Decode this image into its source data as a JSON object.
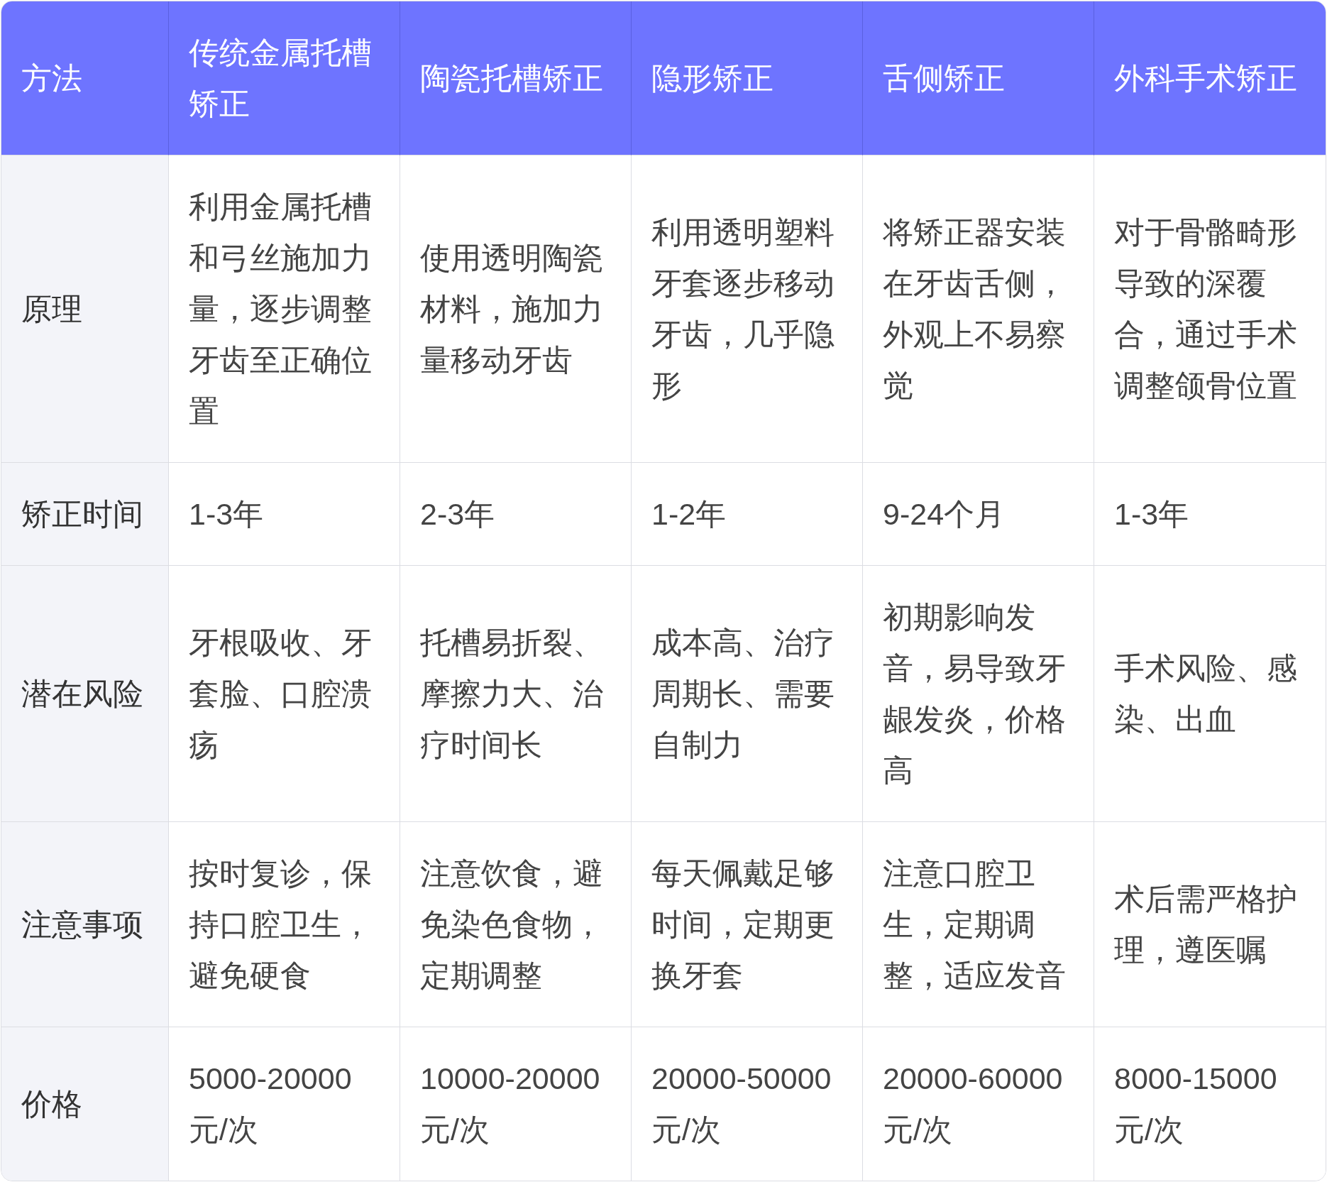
{
  "table": {
    "columns": [
      "方法",
      "传统金属托槽矫正",
      "陶瓷托槽矫正",
      "隐形矫正",
      "舌侧矫正",
      "外科手术矫正"
    ],
    "rows": [
      {
        "cells": [
          "原理",
          "利用金属托槽和弓丝施加力量，逐步调整牙齿至正确位置",
          "使用透明陶瓷材料，施加力量移动牙齿",
          "利用透明塑料牙套逐步移动牙齿，几乎隐形",
          "将矫正器安装在牙齿舌侧，外观上不易察觉",
          "对于骨骼畸形导致的深覆合，通过手术调整颌骨位置"
        ]
      },
      {
        "cells": [
          "矫正时间",
          "1-3年",
          "2-3年",
          "1-2年",
          "9-24个月",
          "1-3年"
        ]
      },
      {
        "cells": [
          "潜在风险",
          "牙根吸收、牙套脸、口腔溃疡",
          "托槽易折裂、摩擦力大、治疗时间长",
          "成本高、治疗周期长、需要自制力",
          "初期影响发音，易导致牙龈发炎，价格高",
          "手术风险、感染、出血"
        ]
      },
      {
        "cells": [
          "注意事项",
          "按时复诊，保持口腔卫生，避免硬食",
          "注意饮食，避免染色食物，定期调整",
          "每天佩戴足够时间，定期更换牙套",
          "注意口腔卫生，定期调整，适应发音",
          "术后需严格护理，遵医嘱"
        ]
      },
      {
        "cells": [
          "价格",
          "5000-20000元/次",
          "10000-20000元/次",
          "20000-50000元/次",
          "20000-60000元/次",
          "8000-15000元/次"
        ]
      }
    ]
  }
}
